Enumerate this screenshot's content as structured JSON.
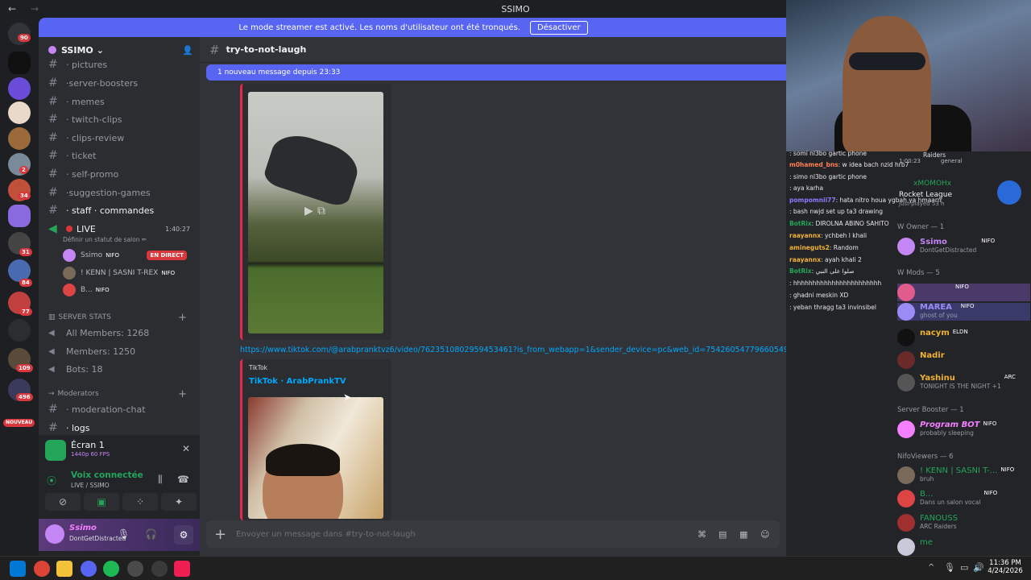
{
  "titlebar": {
    "title": "SSIMO",
    "back": "←",
    "forward": "→"
  },
  "banner": {
    "text": "Le mode streamer est activé. Les noms d'utilisateur ont été tronqués.",
    "button": "Désactiver"
  },
  "server": {
    "name": "SSIMO"
  },
  "server_badges": [
    "90",
    "2",
    "34",
    "31",
    "84",
    "77",
    "109",
    "496",
    "NOUVEAU"
  ],
  "channels": [
    "· pictures",
    "·server-boosters",
    "· memes",
    "· twitch-clips",
    "· clips-review",
    "· ticket",
    "· self-promo",
    "·suggestion-games",
    "· staff · commandes"
  ],
  "voice": {
    "name": "LIVE",
    "timer": "1:40:27",
    "status": "Définir un statut de salon ✏",
    "users": [
      {
        "name": "Ssimo",
        "tag": "NIFO",
        "live": "EN DIRECT"
      },
      {
        "name": "! KENN | SASNI T-REX",
        "tag": "NIFO"
      },
      {
        "name": "B...",
        "tag": "NIFO"
      }
    ]
  },
  "stats": {
    "category": "SERVER STATS",
    "items": [
      "All Members: 1268",
      "Members: 1250",
      "Bots: 18"
    ]
  },
  "moderators": {
    "category": "Moderators",
    "items": [
      "· moderation-chat",
      "· logs"
    ]
  },
  "panel": {
    "screen": "Écran 1",
    "quality": "1440p 60 FPS",
    "voice": "Voix connectée",
    "voice_sub": "LIVE / SSIMO",
    "user": "Ssimo",
    "user_status": "DontGetDistracted"
  },
  "chat": {
    "channel": "try-to-not-laugh",
    "new_messages": "1 nouveau message depuis 23:33",
    "link": "https://www.tiktok.com/@arabpranktvz6/video/7623510802959453461?is_from_webapp=1&sender_device=pc&web_id=7542605477966054968",
    "embed_provider": "TikTok",
    "embed_title": "TikTok · ArabPrankTV",
    "placeholder": "Envoyer un message dans #try-to-not-laugh"
  },
  "stream_chat": [
    {
      "user": "",
      "text": ": somi nl3bo gartic phone"
    },
    {
      "user": "m0hamed_bns",
      "text": ": w idea bach nzid hrb7"
    },
    {
      "user": "",
      "text": ": simo nl3bo gartic phone"
    },
    {
      "user": "",
      "text": ": aya karha"
    },
    {
      "user": "pompomnii77",
      "text": ": hata nitro houa ygbah ya hmaarrr"
    },
    {
      "user": "",
      "text": ": bash nwjd set up ta3 drawing"
    },
    {
      "user": "BotRix",
      "text": ": DIROLNA ABINO SAHITO"
    },
    {
      "user": "raayannx",
      "text": ": ychbeh l khali"
    },
    {
      "user": "amineguts2",
      "text": ": Random"
    },
    {
      "user": "raayannx",
      "text": ": ayah khali 2"
    },
    {
      "user": "BotRix",
      "text": ": صلوا على النبي"
    },
    {
      "user": "",
      "text": ": hhhhhhhhhhhhhhhhhhhhhhh"
    },
    {
      "user": "",
      "text": ": ghadni meskin XD"
    },
    {
      "user": "",
      "text": ": yeban thragg ta3 invinsibel"
    }
  ],
  "stream_overlay": {
    "game_user": "xMOMOHx",
    "game": "Rocket League",
    "played": "Just played 53 h",
    "voice_timer": "1:00:23",
    "voice_channel": "general",
    "raiders": "Raiders"
  },
  "members": {
    "groups": [
      {
        "label": "W Owner — 1"
      },
      {
        "label": "W Mods — 5"
      },
      {
        "label": "Server Booster — 1"
      },
      {
        "label": "NifoViewers — 6"
      }
    ],
    "list": [
      {
        "name": "Ssimo",
        "tag": "NIFO",
        "status": "DontGetDistracted",
        "color": "#c586f5"
      },
      {
        "name": "",
        "tag": "NIFO",
        "status": "",
        "color": "#e05c8a"
      },
      {
        "name": "MAREA",
        "tag": "NIFO",
        "status": "ghost of you",
        "color": "#9b8cf5"
      },
      {
        "name": "nacym",
        "tag": "ELDN",
        "status": "",
        "color": "#f0b232"
      },
      {
        "name": "Nadir",
        "tag": "",
        "status": "",
        "color": "#f0b232"
      },
      {
        "name": "Yashinu",
        "tag": "ARC",
        "status": "TONIGHT IS THE NIGHT +1",
        "color": "#f0b232"
      },
      {
        "name": "Program BOT",
        "tag": "NIFO",
        "status": "probably sleeping",
        "color": "#f47fff"
      },
      {
        "name": "! KENN | SASNI T-...",
        "tag": "NIFO",
        "status": "bruh",
        "color": "#23a55a"
      },
      {
        "name": "B...",
        "tag": "NIFO",
        "status": "Dans un salon vocal",
        "color": "#23a55a"
      },
      {
        "name": "FANOUSS",
        "tag": "",
        "status": "ARC Raiders",
        "color": "#23a55a"
      },
      {
        "name": "me",
        "tag": "",
        "status": "",
        "color": "#23a55a"
      }
    ]
  },
  "taskbar": {
    "time": "11:36 PM",
    "date": "4/24/2026"
  }
}
